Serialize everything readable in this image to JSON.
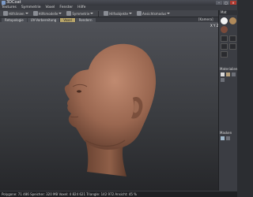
{
  "window": {
    "title": "3DCoat",
    "minimize": "–",
    "maximize": "□",
    "close": "×"
  },
  "menu": [
    {
      "label": "Textures"
    },
    {
      "label": "Symmetrie"
    },
    {
      "label": "Voxel"
    },
    {
      "label": "Fenster"
    },
    {
      "label": "Hilfe"
    }
  ],
  "toolbar": {
    "items": [
      {
        "label": "Hilfslinien",
        "icon": "grid-icon"
      },
      {
        "label": "Hilfsmodelle",
        "icon": "model-icon"
      },
      {
        "label": "Symmetrie",
        "icon": "symmetry-icon"
      },
      {
        "label": "Hilfsobjekte",
        "icon": "object-icon"
      },
      {
        "label": "Ansichtsmodus",
        "icon": "view-icon"
      }
    ]
  },
  "tabs": [
    {
      "label": "Retopologie",
      "active": false
    },
    {
      "label": "UV-Vorbereitung",
      "active": false
    },
    {
      "label": "Voxel",
      "active": true
    },
    {
      "label": "Rendern",
      "active": false
    }
  ],
  "camera_label": "[Kamera]",
  "gizmo": {
    "x": "X",
    "y": "Y",
    "z": "Z"
  },
  "right_panel": {
    "header": "Mat",
    "materials_label": "Materialien",
    "bottom_label": "Masken"
  },
  "status_text": "Polygone: 71 486  Speicher: 320 MB  Voxel: 4 824 621  Triangle: 142 972  Ansicht: 45 %",
  "colors": {
    "accent": "#b9a66a",
    "head_skin": "#9a6750",
    "close": "#b0392f"
  }
}
